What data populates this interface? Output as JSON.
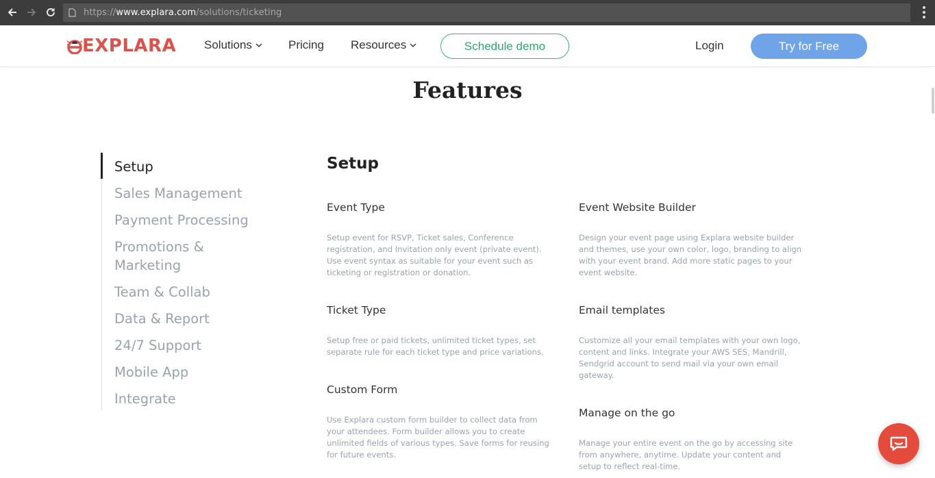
{
  "browser": {
    "url_prefix": "https://",
    "url_host": "www.explara.com",
    "url_path": "/solutions/ticketing"
  },
  "header": {
    "logo_text": "EXPLARA",
    "nav": {
      "solutions": "Solutions",
      "pricing": "Pricing",
      "resources": "Resources"
    },
    "schedule_demo": "Schedule demo",
    "login": "Login",
    "try_free": "Try for Free"
  },
  "colors": {
    "brand_red": "#d9534f",
    "demo_green": "#3bb27a",
    "cta_blue": "#6fa4e8",
    "chat_red": "#e44b3c"
  },
  "page": {
    "title": "Features"
  },
  "sidebar": {
    "items": [
      {
        "label": "Setup",
        "active": true
      },
      {
        "label": "Sales Management"
      },
      {
        "label": "Payment Processing"
      },
      {
        "label": "Promotions & Marketing"
      },
      {
        "label": "Team & Collab"
      },
      {
        "label": "Data & Report"
      },
      {
        "label": "24/7 Support"
      },
      {
        "label": "Mobile App"
      },
      {
        "label": "Integrate"
      }
    ]
  },
  "content": {
    "section_title": "Setup",
    "features": [
      {
        "title": "Event Type",
        "desc": "Setup event for RSVP, Ticket sales, Conference registration, and Invitation only event (private event). Use event syntax as suitable for your event such as ticketing or registration or donation."
      },
      {
        "title": "Event Website Builder",
        "desc": "Design your event page using Explara website builder and themes, use your own color, logo, branding to align with your event brand. Add more static pages to your event website."
      },
      {
        "title": "Ticket Type",
        "desc": "Setup free or paid tickets, unlimited ticket types, set separate rule for each ticket type and price variations."
      },
      {
        "title": "Email templates",
        "desc": "Customize all your email templates with your own logo, content and links. Integrate your AWS SES, Mandrill, Sendgrid account to send mail via your own email gateway."
      },
      {
        "title": "Custom Form",
        "desc": "Use Explara custom form builder to collect data from your attendees. Form builder allows you to create unlimited fields of various types. Save forms for reusing for future events."
      },
      {
        "title": "Manage on the go",
        "desc": "Manage your entire event on the go by accessing site from anywhere, anytime. Update your content and setup to reflect real-time."
      }
    ]
  },
  "icons": {
    "back": "arrow-left-icon",
    "forward": "arrow-right-icon",
    "reload": "reload-icon",
    "page": "page-icon",
    "menu": "kebab-menu-icon",
    "chevron": "chevron-down-icon",
    "chat": "chat-bubble-icon"
  }
}
